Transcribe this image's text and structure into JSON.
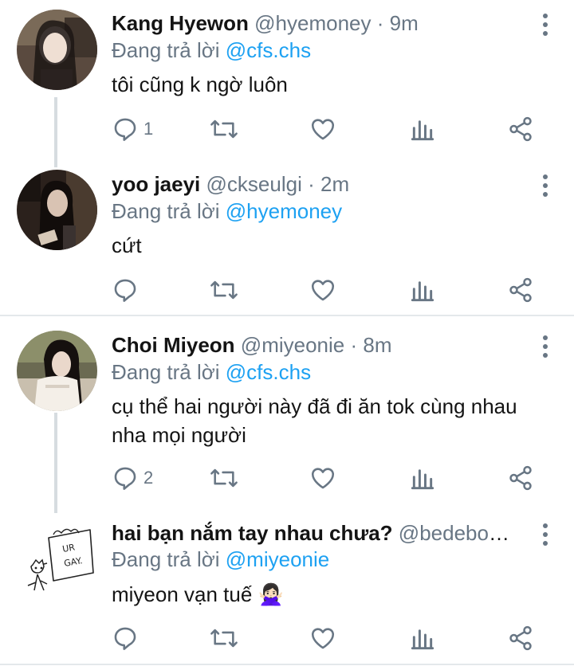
{
  "colors": {
    "accent": "#1da1f2",
    "muted": "#687684",
    "text": "#141414",
    "thread_line": "#d6dce0"
  },
  "tweets": [
    {
      "name": "Kang Hyewon",
      "handle": "@hyemoney",
      "dot": "·",
      "time": "9m",
      "reply_prefix": "Đang trả lời ",
      "reply_mention": "@cfs.chs",
      "text": "tôi cũng k ngờ luôn",
      "reply_count": "1",
      "avatar": "photo-avatar-icon"
    },
    {
      "name": "yoo jaeyi",
      "handle": "@ckseulgi",
      "dot": "·",
      "time": "2m",
      "reply_prefix": "Đang trả lời ",
      "reply_mention": "@hyemoney",
      "text": "cứt",
      "reply_count": "",
      "avatar": "photo-avatar-icon"
    },
    {
      "name": "Choi Miyeon",
      "handle": "@miyeonie",
      "dot": "·",
      "time": "8m",
      "reply_prefix": "Đang trả lời ",
      "reply_mention": "@cfs.chs",
      "text": "cụ thể hai người này đã đi ăn tok cùng nhau nha mọi người",
      "reply_count": "2",
      "avatar": "photo-avatar-icon"
    },
    {
      "name": "hai bạn nắm tay nhau chưa?",
      "handle": "@bedebon…",
      "dot": "",
      "time": "",
      "reply_prefix": "Đang trả lời ",
      "reply_mention": "@miyeonie",
      "text": "miyeon vạn tuế 🙅🏻‍♀️",
      "reply_count": "",
      "avatar": "sketch-avatar-icon",
      "avatar_sign_text": "UR GAY."
    }
  ],
  "icons": [
    "reply-icon",
    "retweet-icon",
    "like-icon",
    "analytics-icon",
    "share-icon",
    "more-options-icon"
  ]
}
